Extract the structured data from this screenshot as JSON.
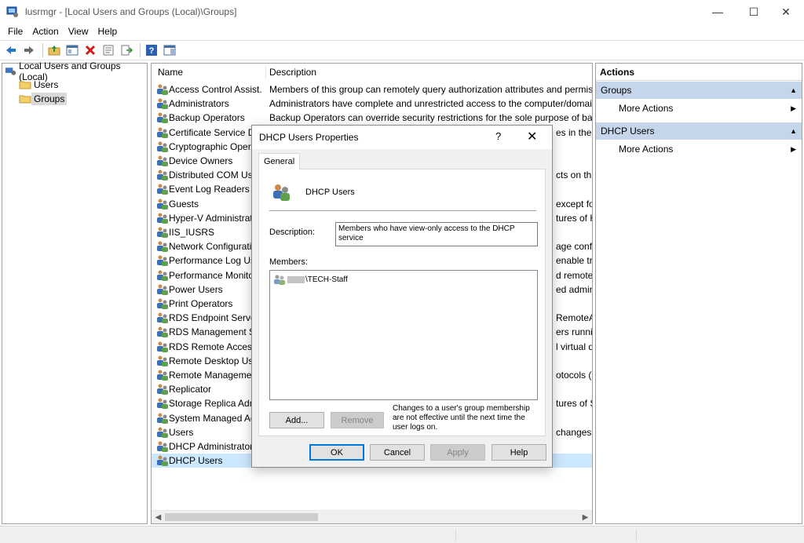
{
  "window": {
    "title": "lusrmgr - [Local Users and Groups (Local)\\Groups]",
    "controls": {
      "minimize": "—",
      "maximize": "☐",
      "close": "✕"
    }
  },
  "menu": [
    "File",
    "Action",
    "View",
    "Help"
  ],
  "toolbar": {
    "icons": [
      "back-arrow-icon",
      "forward-arrow-icon",
      "up-folder-icon",
      "show-hide-tree-icon",
      "delete-icon",
      "properties-icon",
      "export-list-icon",
      "help-icon",
      "action-pane-icon"
    ]
  },
  "tree": {
    "root": "Local Users and Groups (Local)",
    "children": [
      "Users",
      "Groups"
    ],
    "selected": "Groups"
  },
  "list": {
    "columns": [
      "Name",
      "Description"
    ],
    "rows": [
      {
        "name": "Access Control Assist...",
        "desc": "Members of this group can remotely query authorization attributes and permissic"
      },
      {
        "name": "Administrators",
        "desc": "Administrators have complete and unrestricted access to the computer/domain"
      },
      {
        "name": "Backup Operators",
        "desc": "Backup Operators can override security restrictions for the sole purpose of backin"
      },
      {
        "name": "Certificate Service DC",
        "desc": "es in the e"
      },
      {
        "name": "Cryptographic Operat",
        "desc": ""
      },
      {
        "name": "Device Owners",
        "desc": ""
      },
      {
        "name": "Distributed COM User",
        "desc": "cts on this"
      },
      {
        "name": "Event Log Readers",
        "desc": ""
      },
      {
        "name": "Guests",
        "desc": "except fo"
      },
      {
        "name": "Hyper-V Administrato",
        "desc": "tures of H"
      },
      {
        "name": "IIS_IUSRS",
        "desc": ""
      },
      {
        "name": "Network Configuratio",
        "desc": "age config"
      },
      {
        "name": "Performance Log User",
        "desc": "enable tr"
      },
      {
        "name": "Performance Monitor",
        "desc": "d remotely"
      },
      {
        "name": "Power Users",
        "desc": "ed admini"
      },
      {
        "name": "Print Operators",
        "desc": ""
      },
      {
        "name": "RDS Endpoint Servers",
        "desc": "RemoteA"
      },
      {
        "name": "RDS Management Ser",
        "desc": "ers runnir"
      },
      {
        "name": "RDS Remote Access S",
        "desc": "l virtual d"
      },
      {
        "name": "Remote Desktop User",
        "desc": ""
      },
      {
        "name": "Remote Management",
        "desc": "otocols (s"
      },
      {
        "name": "Replicator",
        "desc": ""
      },
      {
        "name": "Storage Replica Adm",
        "desc": "tures of St"
      },
      {
        "name": "System Managed Acc",
        "desc": ""
      },
      {
        "name": "Users",
        "desc": "changes"
      },
      {
        "name": "DHCP Administrators",
        "desc": ""
      },
      {
        "name": "DHCP Users",
        "desc": ""
      }
    ],
    "selected_index": 26
  },
  "actions": {
    "title": "Actions",
    "sections": [
      {
        "label": "Groups",
        "item": "More Actions"
      },
      {
        "label": "DHCP Users",
        "item": "More Actions"
      }
    ]
  },
  "dialog": {
    "title": "DHCP Users Properties",
    "help": "?",
    "close": "✕",
    "tab": "General",
    "group_name": "DHCP Users",
    "description_label": "Description:",
    "description_value": "Members who have view-only access to the DHCP service",
    "members_label": "Members:",
    "members": [
      "\\TECH-Staff"
    ],
    "add": "Add...",
    "remove": "Remove",
    "note": "Changes to a user's group membership are not effective until the next time the user logs on.",
    "ok": "OK",
    "cancel": "Cancel",
    "apply": "Apply",
    "help_btn": "Help"
  },
  "colors": {
    "selection_row": "#cce8ff",
    "actions_section": "#c5d6ea",
    "dialog_bg": "#f0f0f0"
  }
}
